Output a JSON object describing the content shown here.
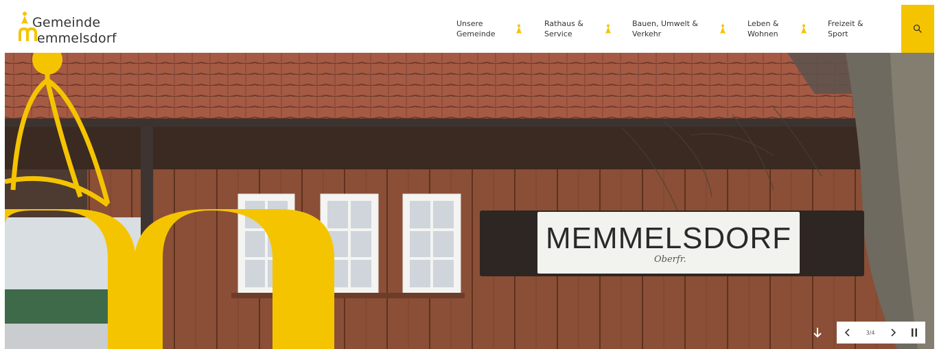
{
  "logo": {
    "line1": "Gemeinde",
    "line2": "emmelsdorf"
  },
  "nav": [
    {
      "label": "Unsere\nGemeinde"
    },
    {
      "label": "Rathaus &\nService"
    },
    {
      "label": "Bauen, Umwelt &\nVerkehr"
    },
    {
      "label": "Leben &\nWohnen"
    },
    {
      "label": "Freizeit &\nSport"
    }
  ],
  "hero": {
    "sign_main": "MEMMELSDORF",
    "sign_sub": "Oberfr.",
    "slide_counter": "3/4"
  },
  "icons": {
    "search": "search-icon",
    "prev": "chevron-left-icon",
    "next": "chevron-right-icon",
    "pause": "pause-icon",
    "scroll": "arrow-down-icon"
  },
  "colors": {
    "brand_yellow": "#f5c400",
    "text_dark": "#333333"
  }
}
